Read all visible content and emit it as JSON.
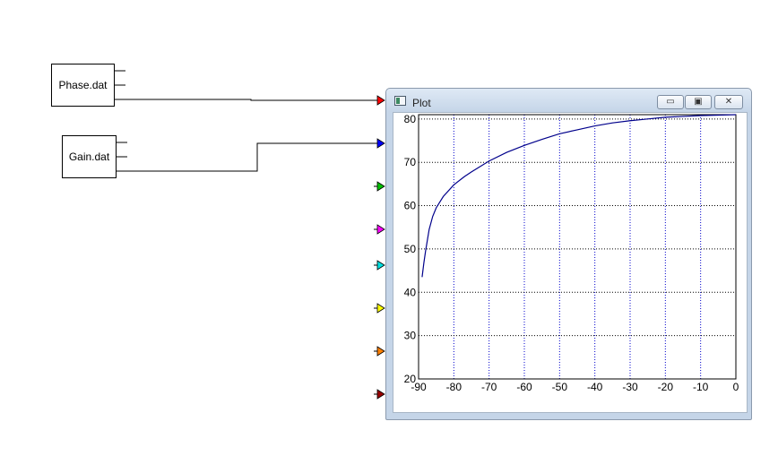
{
  "blocks": {
    "phase_label": "Phase.dat",
    "gain_label": "Gain.dat"
  },
  "input_port_colors": [
    "#ff0000",
    "#0000ff",
    "#00c000",
    "#ff00ff",
    "#00e0e0",
    "#ffff00",
    "#ff8000",
    "#990000"
  ],
  "window": {
    "title": "Plot",
    "minimize_icon": "minimize-icon",
    "maximize_icon": "maximize-icon",
    "close_icon": "close-icon"
  },
  "chart_data": {
    "type": "line",
    "xlim": [
      -90,
      0
    ],
    "ylim": [
      20,
      81
    ],
    "x_ticks": [
      "-90",
      "-80",
      "-70",
      "-60",
      "-50",
      "-40",
      "-30",
      "-20",
      "-10",
      "0"
    ],
    "y_ticks": [
      "80",
      "70",
      "60",
      "50",
      "40",
      "30",
      "20"
    ],
    "grid": true,
    "line_color": "#00008b",
    "series": [
      {
        "x": [
          -89,
          -88.5,
          -88,
          -87,
          -86,
          -85,
          -83,
          -80,
          -77,
          -75,
          -70,
          -65,
          -60,
          -55,
          -50,
          -45,
          -40,
          -35,
          -30,
          -25,
          -20,
          -15,
          -10,
          -5,
          0
        ],
        "values": [
          43.5,
          46.8,
          49.6,
          54.5,
          57.5,
          59.5,
          62.1,
          64.8,
          66.7,
          67.8,
          70.3,
          72.3,
          73.9,
          75.3,
          76.6,
          77.5,
          78.4,
          79.1,
          79.6,
          80.0,
          80.4,
          80.6,
          80.8,
          80.9,
          81.0
        ]
      }
    ]
  }
}
